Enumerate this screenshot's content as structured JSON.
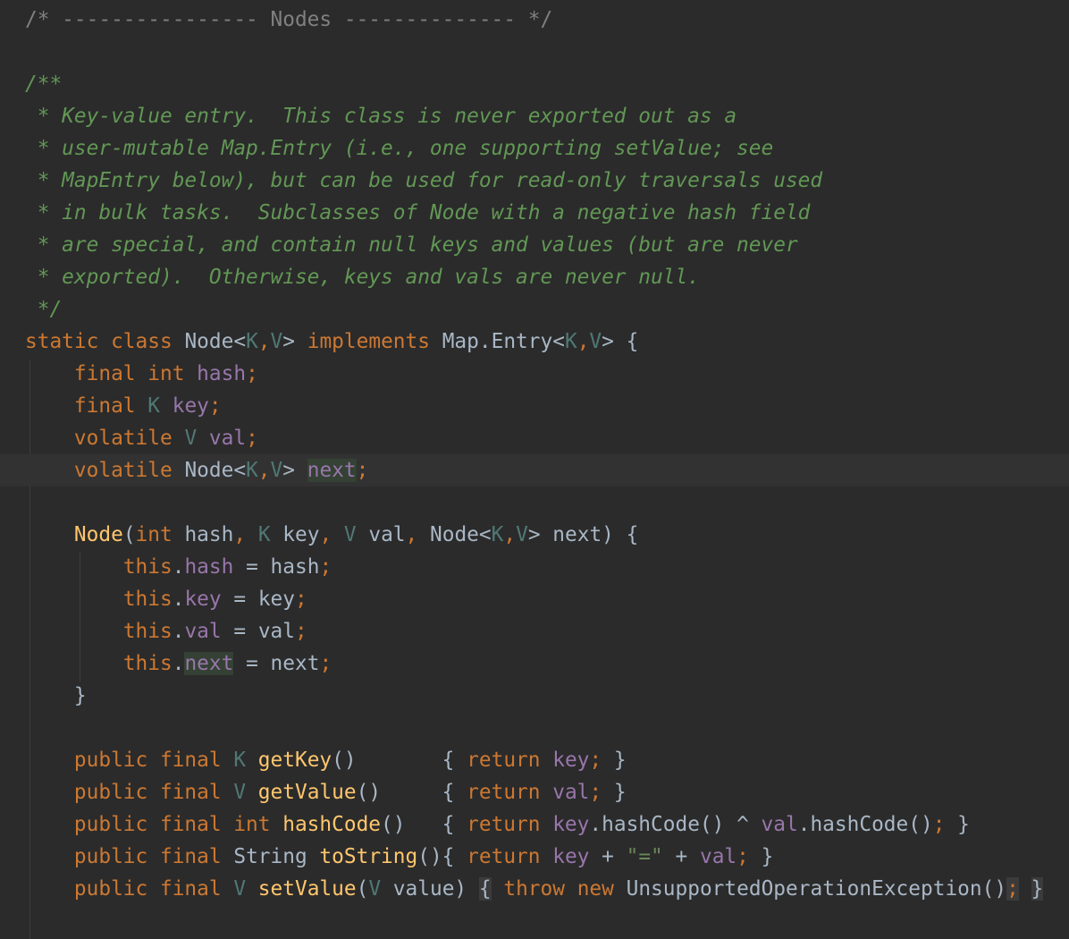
{
  "editor": {
    "theme_colors": {
      "background": "#2b2b2b",
      "current_line": "#323232",
      "plain": "#a9b7c6",
      "keyword": "#cc7832",
      "comment": "#808080",
      "doc_comment": "#629755",
      "type_param": "#507874",
      "field": "#9876aa",
      "method": "#ffc66d",
      "string": "#6a8759"
    },
    "lines": [
      {
        "tokens": [
          {
            "t": "/* ---------------- Nodes -------------- */",
            "c": "com"
          }
        ]
      },
      {
        "tokens": []
      },
      {
        "tokens": [
          {
            "t": "/**",
            "c": "doc"
          }
        ]
      },
      {
        "tokens": [
          {
            "t": " * Key-value entry.  This class is never exported out as a",
            "c": "doc"
          }
        ]
      },
      {
        "tokens": [
          {
            "t": " * user-mutable Map.Entry (i.e., one supporting setValue; see",
            "c": "doc"
          }
        ]
      },
      {
        "tokens": [
          {
            "t": " * MapEntry below), but can be used for read-only traversals used",
            "c": "doc"
          }
        ]
      },
      {
        "tokens": [
          {
            "t": " * in bulk tasks.  Subclasses of Node with a negative hash field",
            "c": "doc"
          }
        ]
      },
      {
        "tokens": [
          {
            "t": " * are special, and contain null keys and values (but are never",
            "c": "doc"
          }
        ]
      },
      {
        "tokens": [
          {
            "t": " * exported).  Otherwise, keys and vals are never null.",
            "c": "doc"
          }
        ]
      },
      {
        "tokens": [
          {
            "t": " */",
            "c": "doc"
          }
        ]
      },
      {
        "tokens": [
          {
            "t": "static class ",
            "c": "kw"
          },
          {
            "t": "Node<",
            "c": ""
          },
          {
            "t": "K",
            "c": "tp"
          },
          {
            "t": ",",
            "c": "kw"
          },
          {
            "t": "V",
            "c": "tp"
          },
          {
            "t": "> ",
            "c": ""
          },
          {
            "t": "implements ",
            "c": "kw"
          },
          {
            "t": "Map.Entry<",
            "c": ""
          },
          {
            "t": "K",
            "c": "tp"
          },
          {
            "t": ",",
            "c": "kw"
          },
          {
            "t": "V",
            "c": "tp"
          },
          {
            "t": "> {",
            "c": ""
          }
        ]
      },
      {
        "tokens": [
          {
            "t": "    ",
            "c": ""
          },
          {
            "t": "final int ",
            "c": "kw"
          },
          {
            "t": "hash",
            "c": "fld"
          },
          {
            "t": ";",
            "c": "kw"
          }
        ]
      },
      {
        "tokens": [
          {
            "t": "    ",
            "c": ""
          },
          {
            "t": "final ",
            "c": "kw"
          },
          {
            "t": "K ",
            "c": "tp"
          },
          {
            "t": "key",
            "c": "fld"
          },
          {
            "t": ";",
            "c": "kw"
          }
        ]
      },
      {
        "tokens": [
          {
            "t": "    ",
            "c": ""
          },
          {
            "t": "volatile ",
            "c": "kw"
          },
          {
            "t": "V ",
            "c": "tp"
          },
          {
            "t": "val",
            "c": "fld"
          },
          {
            "t": ";",
            "c": "kw"
          }
        ]
      },
      {
        "caret": true,
        "tokens": [
          {
            "t": "    ",
            "c": ""
          },
          {
            "t": "volatile ",
            "c": "kw"
          },
          {
            "t": "Node<",
            "c": ""
          },
          {
            "t": "K",
            "c": "tp"
          },
          {
            "t": ",",
            "c": "kw"
          },
          {
            "t": "V",
            "c": "tp"
          },
          {
            "t": "> ",
            "c": ""
          },
          {
            "t": "next",
            "c": "fld hl"
          },
          {
            "t": ";",
            "c": "kw"
          }
        ]
      },
      {
        "tokens": []
      },
      {
        "tokens": [
          {
            "t": "    ",
            "c": ""
          },
          {
            "t": "Node",
            "c": "fn"
          },
          {
            "t": "(",
            "c": ""
          },
          {
            "t": "int ",
            "c": "kw"
          },
          {
            "t": "hash",
            "c": ""
          },
          {
            "t": ", ",
            "c": "kw"
          },
          {
            "t": "K ",
            "c": "tp"
          },
          {
            "t": "key",
            "c": ""
          },
          {
            "t": ", ",
            "c": "kw"
          },
          {
            "t": "V ",
            "c": "tp"
          },
          {
            "t": "val",
            "c": ""
          },
          {
            "t": ", ",
            "c": "kw"
          },
          {
            "t": "Node<",
            "c": ""
          },
          {
            "t": "K",
            "c": "tp"
          },
          {
            "t": ",",
            "c": "kw"
          },
          {
            "t": "V",
            "c": "tp"
          },
          {
            "t": "> next) {",
            "c": ""
          }
        ]
      },
      {
        "tokens": [
          {
            "t": "        ",
            "c": ""
          },
          {
            "t": "this",
            "c": "kw"
          },
          {
            "t": ".",
            "c": ""
          },
          {
            "t": "hash",
            "c": "fld"
          },
          {
            "t": " = hash",
            "c": ""
          },
          {
            "t": ";",
            "c": "kw"
          }
        ]
      },
      {
        "tokens": [
          {
            "t": "        ",
            "c": ""
          },
          {
            "t": "this",
            "c": "kw"
          },
          {
            "t": ".",
            "c": ""
          },
          {
            "t": "key",
            "c": "fld"
          },
          {
            "t": " = key",
            "c": ""
          },
          {
            "t": ";",
            "c": "kw"
          }
        ]
      },
      {
        "tokens": [
          {
            "t": "        ",
            "c": ""
          },
          {
            "t": "this",
            "c": "kw"
          },
          {
            "t": ".",
            "c": ""
          },
          {
            "t": "val",
            "c": "fld"
          },
          {
            "t": " = val",
            "c": ""
          },
          {
            "t": ";",
            "c": "kw"
          }
        ]
      },
      {
        "tokens": [
          {
            "t": "        ",
            "c": ""
          },
          {
            "t": "this",
            "c": "kw"
          },
          {
            "t": ".",
            "c": ""
          },
          {
            "t": "next",
            "c": "fld hl"
          },
          {
            "t": " = next",
            "c": ""
          },
          {
            "t": ";",
            "c": "kw"
          }
        ]
      },
      {
        "tokens": [
          {
            "t": "    }",
            "c": ""
          }
        ]
      },
      {
        "tokens": []
      },
      {
        "tokens": [
          {
            "t": "    ",
            "c": ""
          },
          {
            "t": "public final ",
            "c": "kw"
          },
          {
            "t": "K ",
            "c": "tp"
          },
          {
            "t": "getKey",
            "c": "fn"
          },
          {
            "t": "()       { ",
            "c": ""
          },
          {
            "t": "return ",
            "c": "kw"
          },
          {
            "t": "key",
            "c": "fld"
          },
          {
            "t": "; ",
            "c": "kw"
          },
          {
            "t": "}",
            "c": ""
          }
        ]
      },
      {
        "tokens": [
          {
            "t": "    ",
            "c": ""
          },
          {
            "t": "public final ",
            "c": "kw"
          },
          {
            "t": "V ",
            "c": "tp"
          },
          {
            "t": "getValue",
            "c": "fn"
          },
          {
            "t": "()     { ",
            "c": ""
          },
          {
            "t": "return ",
            "c": "kw"
          },
          {
            "t": "val",
            "c": "fld"
          },
          {
            "t": "; ",
            "c": "kw"
          },
          {
            "t": "}",
            "c": ""
          }
        ]
      },
      {
        "tokens": [
          {
            "t": "    ",
            "c": ""
          },
          {
            "t": "public final int ",
            "c": "kw"
          },
          {
            "t": "hashCode",
            "c": "fn"
          },
          {
            "t": "()   { ",
            "c": ""
          },
          {
            "t": "return ",
            "c": "kw"
          },
          {
            "t": "key",
            "c": "fld"
          },
          {
            "t": ".hashCode() ^ ",
            "c": ""
          },
          {
            "t": "val",
            "c": "fld"
          },
          {
            "t": ".hashCode()",
            "c": ""
          },
          {
            "t": "; ",
            "c": "kw"
          },
          {
            "t": "}",
            "c": ""
          }
        ]
      },
      {
        "tokens": [
          {
            "t": "    ",
            "c": ""
          },
          {
            "t": "public final ",
            "c": "kw"
          },
          {
            "t": "String ",
            "c": ""
          },
          {
            "t": "toString",
            "c": "fn"
          },
          {
            "t": "(){ ",
            "c": ""
          },
          {
            "t": "return ",
            "c": "kw"
          },
          {
            "t": "key",
            "c": "fld"
          },
          {
            "t": " + ",
            "c": ""
          },
          {
            "t": "\"=\"",
            "c": "str"
          },
          {
            "t": " + ",
            "c": ""
          },
          {
            "t": "val",
            "c": "fld"
          },
          {
            "t": "; ",
            "c": "kw"
          },
          {
            "t": "}",
            "c": ""
          }
        ]
      },
      {
        "tokens": [
          {
            "t": "    ",
            "c": ""
          },
          {
            "t": "public final ",
            "c": "kw"
          },
          {
            "t": "V ",
            "c": "tp"
          },
          {
            "t": "setValue",
            "c": "fn"
          },
          {
            "t": "(",
            "c": ""
          },
          {
            "t": "V ",
            "c": "tp"
          },
          {
            "t": "value) ",
            "c": ""
          },
          {
            "t": "{",
            "c": "hl2"
          },
          {
            "t": " ",
            "c": ""
          },
          {
            "t": "throw new ",
            "c": "kw"
          },
          {
            "t": "UnsupportedOperationException()",
            "c": ""
          },
          {
            "t": ";",
            "c": "kw hl2"
          },
          {
            "t": " ",
            "c": ""
          },
          {
            "t": "}",
            "c": "hl2"
          }
        ]
      }
    ]
  }
}
